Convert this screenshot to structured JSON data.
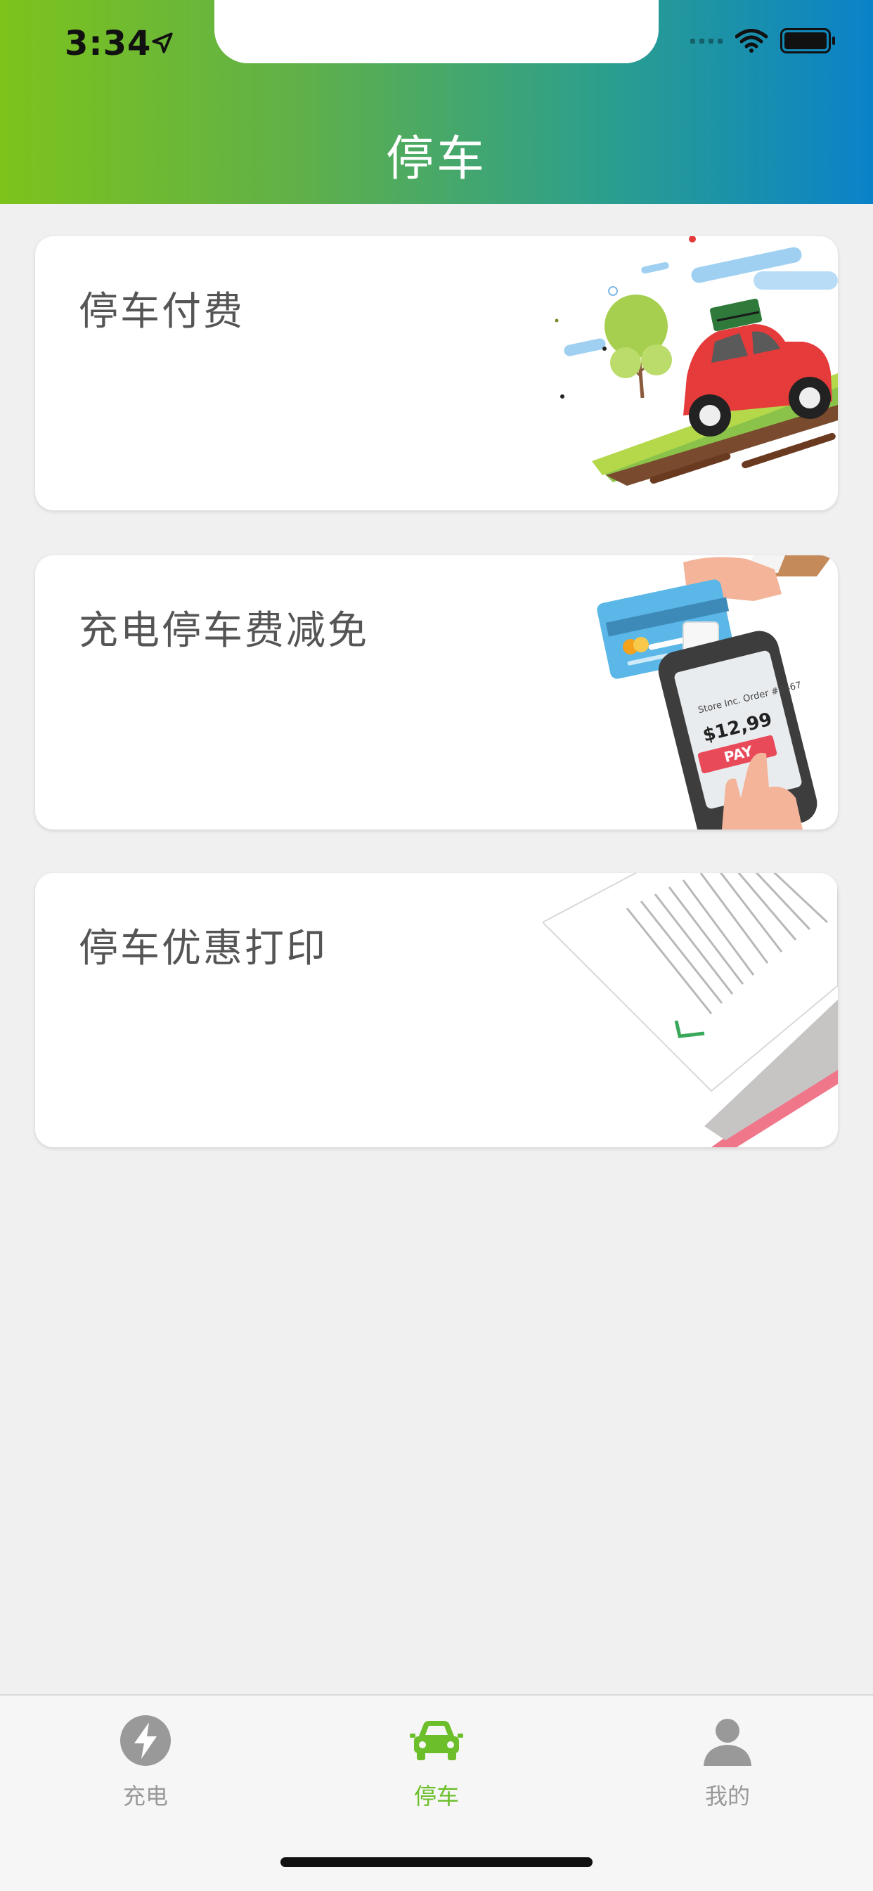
{
  "status_bar": {
    "time": "3:34"
  },
  "nav": {
    "title": "停车"
  },
  "cards": [
    {
      "label": "停车付费",
      "illustration": "red-car-illustration"
    },
    {
      "label": "充电停车费减免",
      "illustration": "phone-payment-illustration",
      "price_text": "$12,99",
      "pay_text": "PAY",
      "store_text": "Store Inc. Order #3467"
    },
    {
      "label": "停车优惠打印",
      "illustration": "receipt-print-illustration"
    }
  ],
  "tabbar": {
    "tabs": [
      {
        "label": "充电",
        "icon": "lightning-icon",
        "active": false
      },
      {
        "label": "停车",
        "icon": "car-icon",
        "active": true
      },
      {
        "label": "我的",
        "icon": "user-icon",
        "active": false
      }
    ]
  },
  "colors": {
    "accent": "#6cbf2a",
    "header_start": "#7dc31c",
    "header_end": "#0a82c9",
    "inactive": "#999999"
  }
}
